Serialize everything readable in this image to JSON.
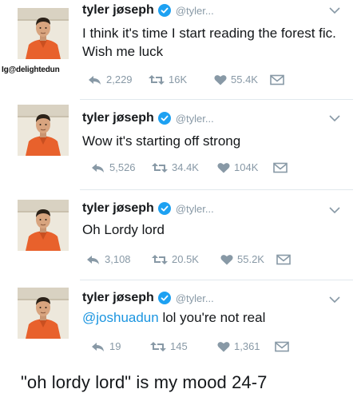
{
  "watermark": "Ig@delightedun",
  "tweets": [
    {
      "name": "tyler jøseph",
      "handle": "@tyler...",
      "text": "I think it's time I start reading the forest fic. Wish me luck",
      "mention": "",
      "replies": "2,229",
      "retweets": "16K",
      "likes": "55.4K"
    },
    {
      "name": "tyler jøseph",
      "handle": "@tyler...",
      "text": "Wow it's starting off strong",
      "mention": "",
      "replies": "5,526",
      "retweets": "34.4K",
      "likes": "104K"
    },
    {
      "name": "tyler jøseph",
      "handle": "@tyler...",
      "text": "Oh Lordy lord",
      "mention": "",
      "replies": "3,108",
      "retweets": "20.5K",
      "likes": "55.2K"
    },
    {
      "name": "tyler jøseph",
      "handle": "@tyler...",
      "text": " lol you're not real",
      "mention": "@joshuadun",
      "replies": "19",
      "retweets": "145",
      "likes": "1,361"
    }
  ],
  "caption": "\"oh lordy lord\" is my mood 24-7",
  "colors": {
    "accent": "#1da1f2",
    "muted": "#8899a6",
    "jumpsuit": "#e8612c"
  },
  "icons": {
    "verified": "verified-badge-icon",
    "reply": "reply-arrow-icon",
    "retweet": "retweet-icon",
    "like": "heart-icon",
    "dm": "envelope-icon",
    "more": "chevron-down-icon"
  }
}
